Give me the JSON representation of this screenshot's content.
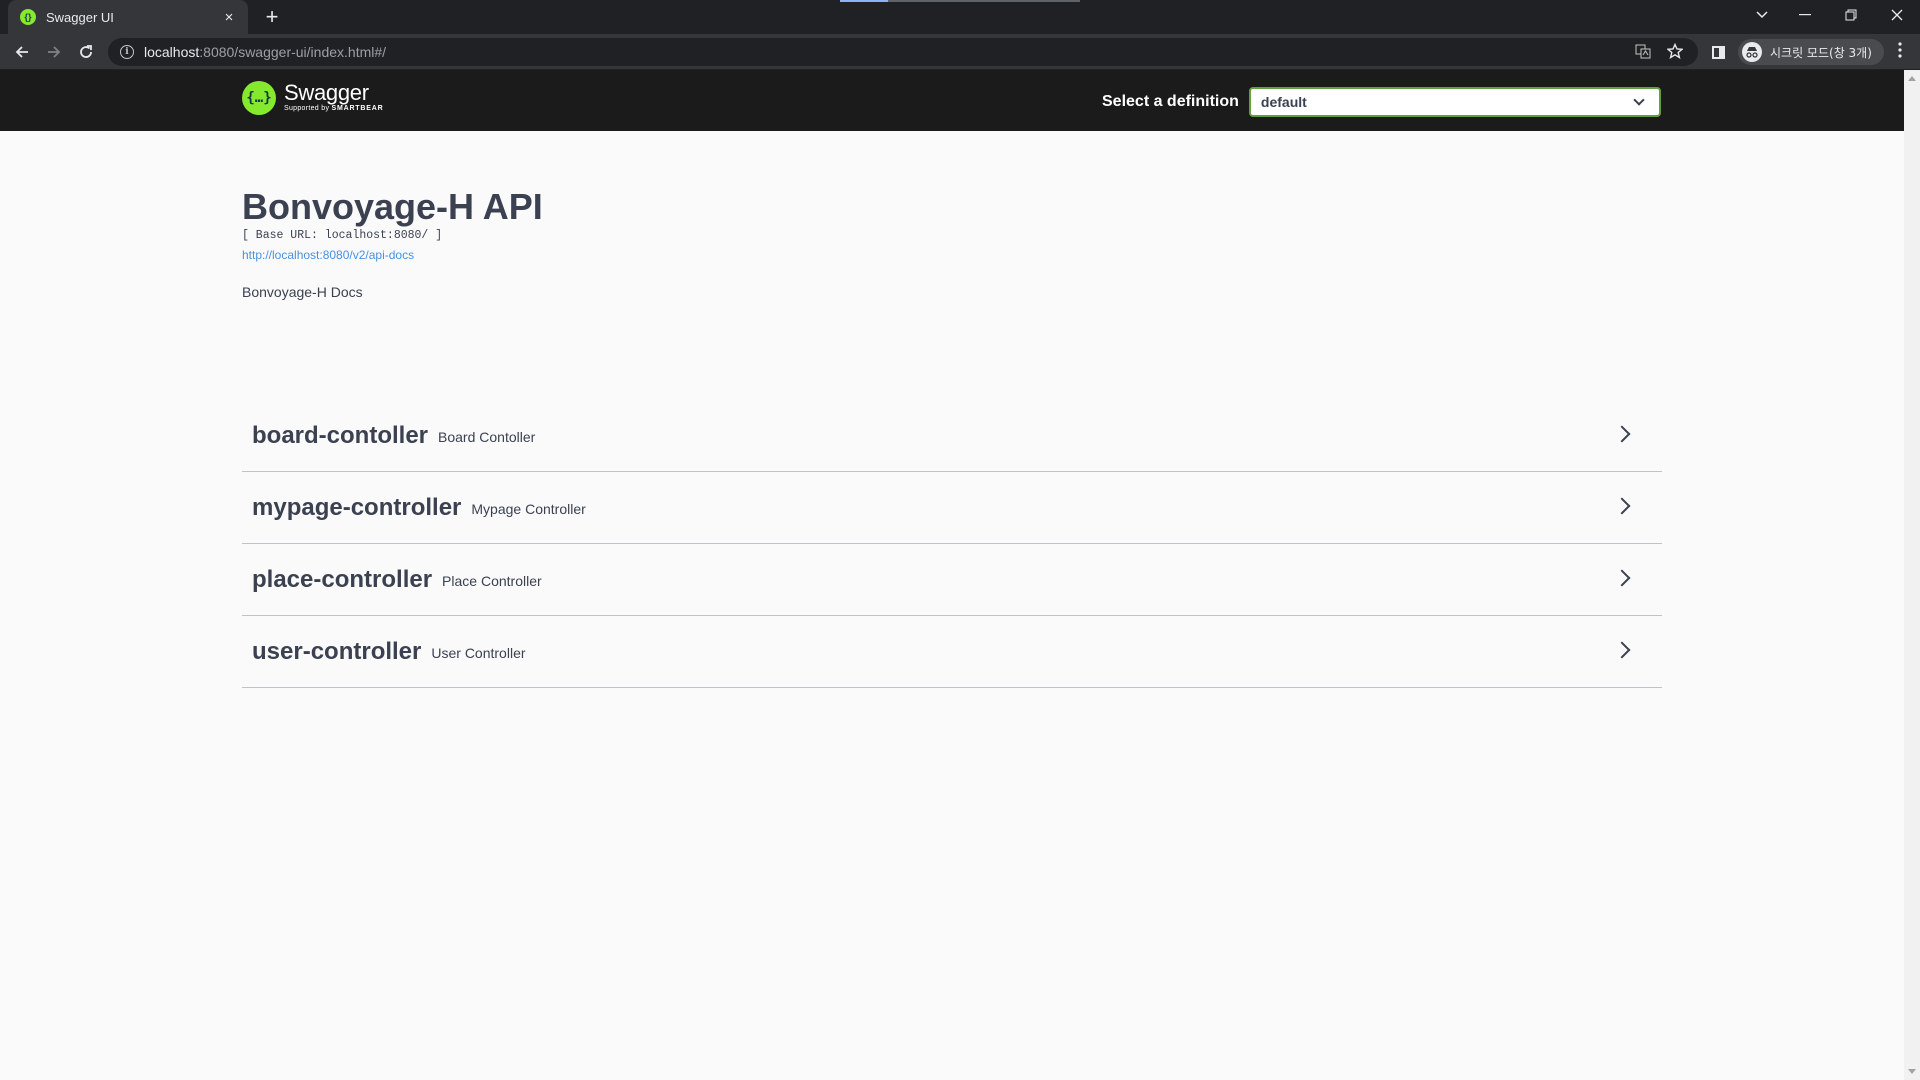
{
  "browser": {
    "tab_title": "Swagger UI",
    "tab_close": "×",
    "new_tab": "+",
    "url_host": "localhost",
    "url_path": ":8080/swagger-ui/index.html#/",
    "incognito_label": "시크릿 모드(창 3개)",
    "icons": [
      "back-icon",
      "forward-icon",
      "reload-icon",
      "info-icon",
      "translate-icon",
      "star-icon",
      "side-panel-icon",
      "incognito-icon",
      "menu-icon"
    ]
  },
  "swagger": {
    "logo_name": "Swagger",
    "logo_sub_prefix": "Supported by",
    "logo_sub_brand": "SMARTBEAR",
    "definition_label": "Select a definition",
    "definition_value": "default",
    "accent_color": "#85ea2d"
  },
  "info": {
    "title": "Bonvoyage-H API",
    "base_url": "[ Base URL: localhost:8080/ ]",
    "spec_link": "http://localhost:8080/v2/api-docs",
    "description": "Bonvoyage-H Docs"
  },
  "tags": [
    {
      "name": "board-contoller",
      "description": "Board Contoller"
    },
    {
      "name": "mypage-controller",
      "description": "Mypage Controller"
    },
    {
      "name": "place-controller",
      "description": "Place Controller"
    },
    {
      "name": "user-controller",
      "description": "User Controller"
    }
  ]
}
